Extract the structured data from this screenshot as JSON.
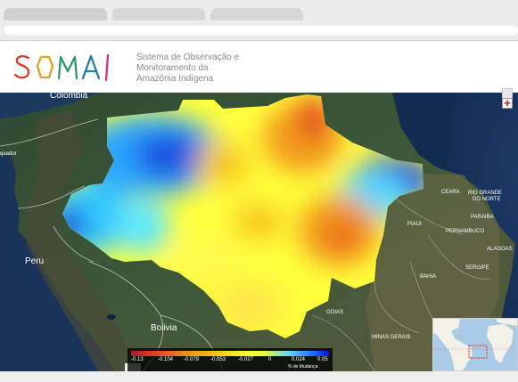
{
  "site": {
    "logo_text": "SOMAI",
    "subtitle": "Sistema de Observação e\nMonitoramento da\nAmazônia Indígena"
  },
  "map": {
    "countries": {
      "colombia": "Colombia",
      "peru": "Peru",
      "bolivia": "Bolivia",
      "equador": "quador"
    },
    "states": {
      "ceara": "CEARA",
      "rgn": "RIO GRANDE\nDO NORTE",
      "paraiba": "PARAIBA",
      "pernambuco": "PERNAMBUCO",
      "piaui": "PIAUI",
      "alagoas": "ALAGOAS",
      "sergipe": "SERGIPE",
      "bahia": "BAHIA",
      "goias": "GOIAS",
      "minas": "MINAS GERAIS"
    }
  },
  "legend": {
    "ticks": [
      "-0.13",
      "-0.104",
      "-0.079",
      "-0.053",
      "-0.027",
      "0",
      "0.024",
      "0.05"
    ],
    "unit": "% de Mudança"
  },
  "colors": {
    "logo_s": "#e03a24",
    "logo_o": "#e8a21a",
    "logo_m": "#2a9a6d",
    "logo_a": "#1f7fa7",
    "logo_i": "#d3328a"
  }
}
